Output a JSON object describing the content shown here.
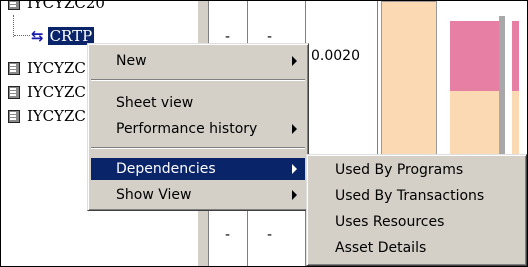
{
  "tree": {
    "items": [
      {
        "label": "IYCYZC20"
      },
      {
        "label": "CRTP"
      },
      {
        "label": "IYCYZC"
      },
      {
        "label": "IYCYZC"
      },
      {
        "label": "IYCYZC"
      }
    ]
  },
  "grid": {
    "cells": {
      "r1c1": "-",
      "r1c2": "-",
      "r1c3": "0.0020",
      "r2c1": "-",
      "r2c2": "-"
    }
  },
  "context_menu": {
    "items": [
      {
        "label": "New",
        "submenu": true
      },
      {
        "label": "Sheet view",
        "submenu": false
      },
      {
        "label": "Performance history",
        "submenu": true
      },
      {
        "label": "Dependencies",
        "submenu": true,
        "highlighted": true
      },
      {
        "label": "Show View",
        "submenu": true
      }
    ]
  },
  "submenu": {
    "items": [
      {
        "label": "Used By Programs"
      },
      {
        "label": "Used By Transactions"
      },
      {
        "label": "Uses Resources"
      },
      {
        "label": "Asset Details"
      }
    ]
  },
  "colors": {
    "selection": "#0a246a",
    "menu_bg": "#d4d0c8",
    "bar_tan": "#fad9b3",
    "bar_pink": "#e67fa3"
  }
}
